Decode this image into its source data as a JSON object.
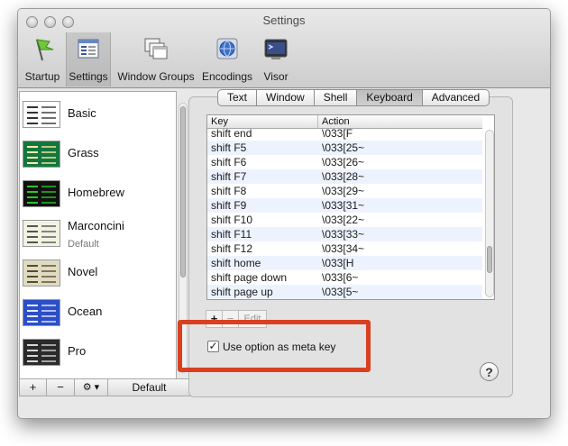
{
  "window": {
    "title": "Settings"
  },
  "toolbar": {
    "items": [
      {
        "label": "Startup",
        "icon": "flag-icon"
      },
      {
        "label": "Settings",
        "icon": "settings-panel-icon",
        "selected": true
      },
      {
        "label": "Window Groups",
        "icon": "window-groups-icon"
      },
      {
        "label": "Encodings",
        "icon": "globe-encodings-icon"
      },
      {
        "label": "Visor",
        "icon": "terminal-visor-icon"
      }
    ]
  },
  "profiles": [
    {
      "name": "Basic",
      "subtitle": "",
      "thumb_bg": "#ffffff",
      "thumb_fg": "#333333"
    },
    {
      "name": "Grass",
      "subtitle": "",
      "thumb_bg": "#13773d",
      "thumb_fg": "#ffe9a8"
    },
    {
      "name": "Homebrew",
      "subtitle": "",
      "thumb_bg": "#111111",
      "thumb_fg": "#28c72a"
    },
    {
      "name": "Marconcini",
      "subtitle": "Default",
      "thumb_bg": "#f2f2e2",
      "thumb_fg": "#555555"
    },
    {
      "name": "Novel",
      "subtitle": "",
      "thumb_bg": "#dfdbc3",
      "thumb_fg": "#5a4a2a"
    },
    {
      "name": "Ocean",
      "subtitle": "",
      "thumb_bg": "#2c4fc8",
      "thumb_fg": "#e8eeff"
    },
    {
      "name": "Pro",
      "subtitle": "",
      "thumb_bg": "#2b2b2b",
      "thumb_fg": "#d8d8d8"
    }
  ],
  "sidebar_buttons": {
    "add": "+",
    "remove": "−",
    "gear": "⚙ ▾",
    "default": "Default"
  },
  "tabs": [
    {
      "label": "Text"
    },
    {
      "label": "Window"
    },
    {
      "label": "Shell"
    },
    {
      "label": "Keyboard",
      "selected": true
    },
    {
      "label": "Advanced"
    }
  ],
  "keytable": {
    "headers": [
      "Key",
      "Action"
    ],
    "rows": [
      {
        "key": "shift end",
        "action": "\\033[F"
      },
      {
        "key": "shift F5",
        "action": "\\033[25~"
      },
      {
        "key": "shift F6",
        "action": "\\033[26~"
      },
      {
        "key": "shift F7",
        "action": "\\033[28~"
      },
      {
        "key": "shift F8",
        "action": "\\033[29~"
      },
      {
        "key": "shift F9",
        "action": "\\033[31~"
      },
      {
        "key": "shift F10",
        "action": "\\033[22~"
      },
      {
        "key": "shift F11",
        "action": "\\033[33~"
      },
      {
        "key": "shift F12",
        "action": "\\033[34~"
      },
      {
        "key": "shift home",
        "action": "\\033[H"
      },
      {
        "key": "shift page down",
        "action": "\\033[6~"
      },
      {
        "key": "shift page up",
        "action": "\\033[5~"
      }
    ]
  },
  "table_buttons": {
    "add": "+",
    "remove": "−",
    "edit": "Edit"
  },
  "option_meta": {
    "label": "Use option as meta key",
    "checked": "✓"
  },
  "help": {
    "label": "?"
  },
  "colors": {
    "highlight": "#d9401f",
    "row_alt": "#edf3fe"
  }
}
